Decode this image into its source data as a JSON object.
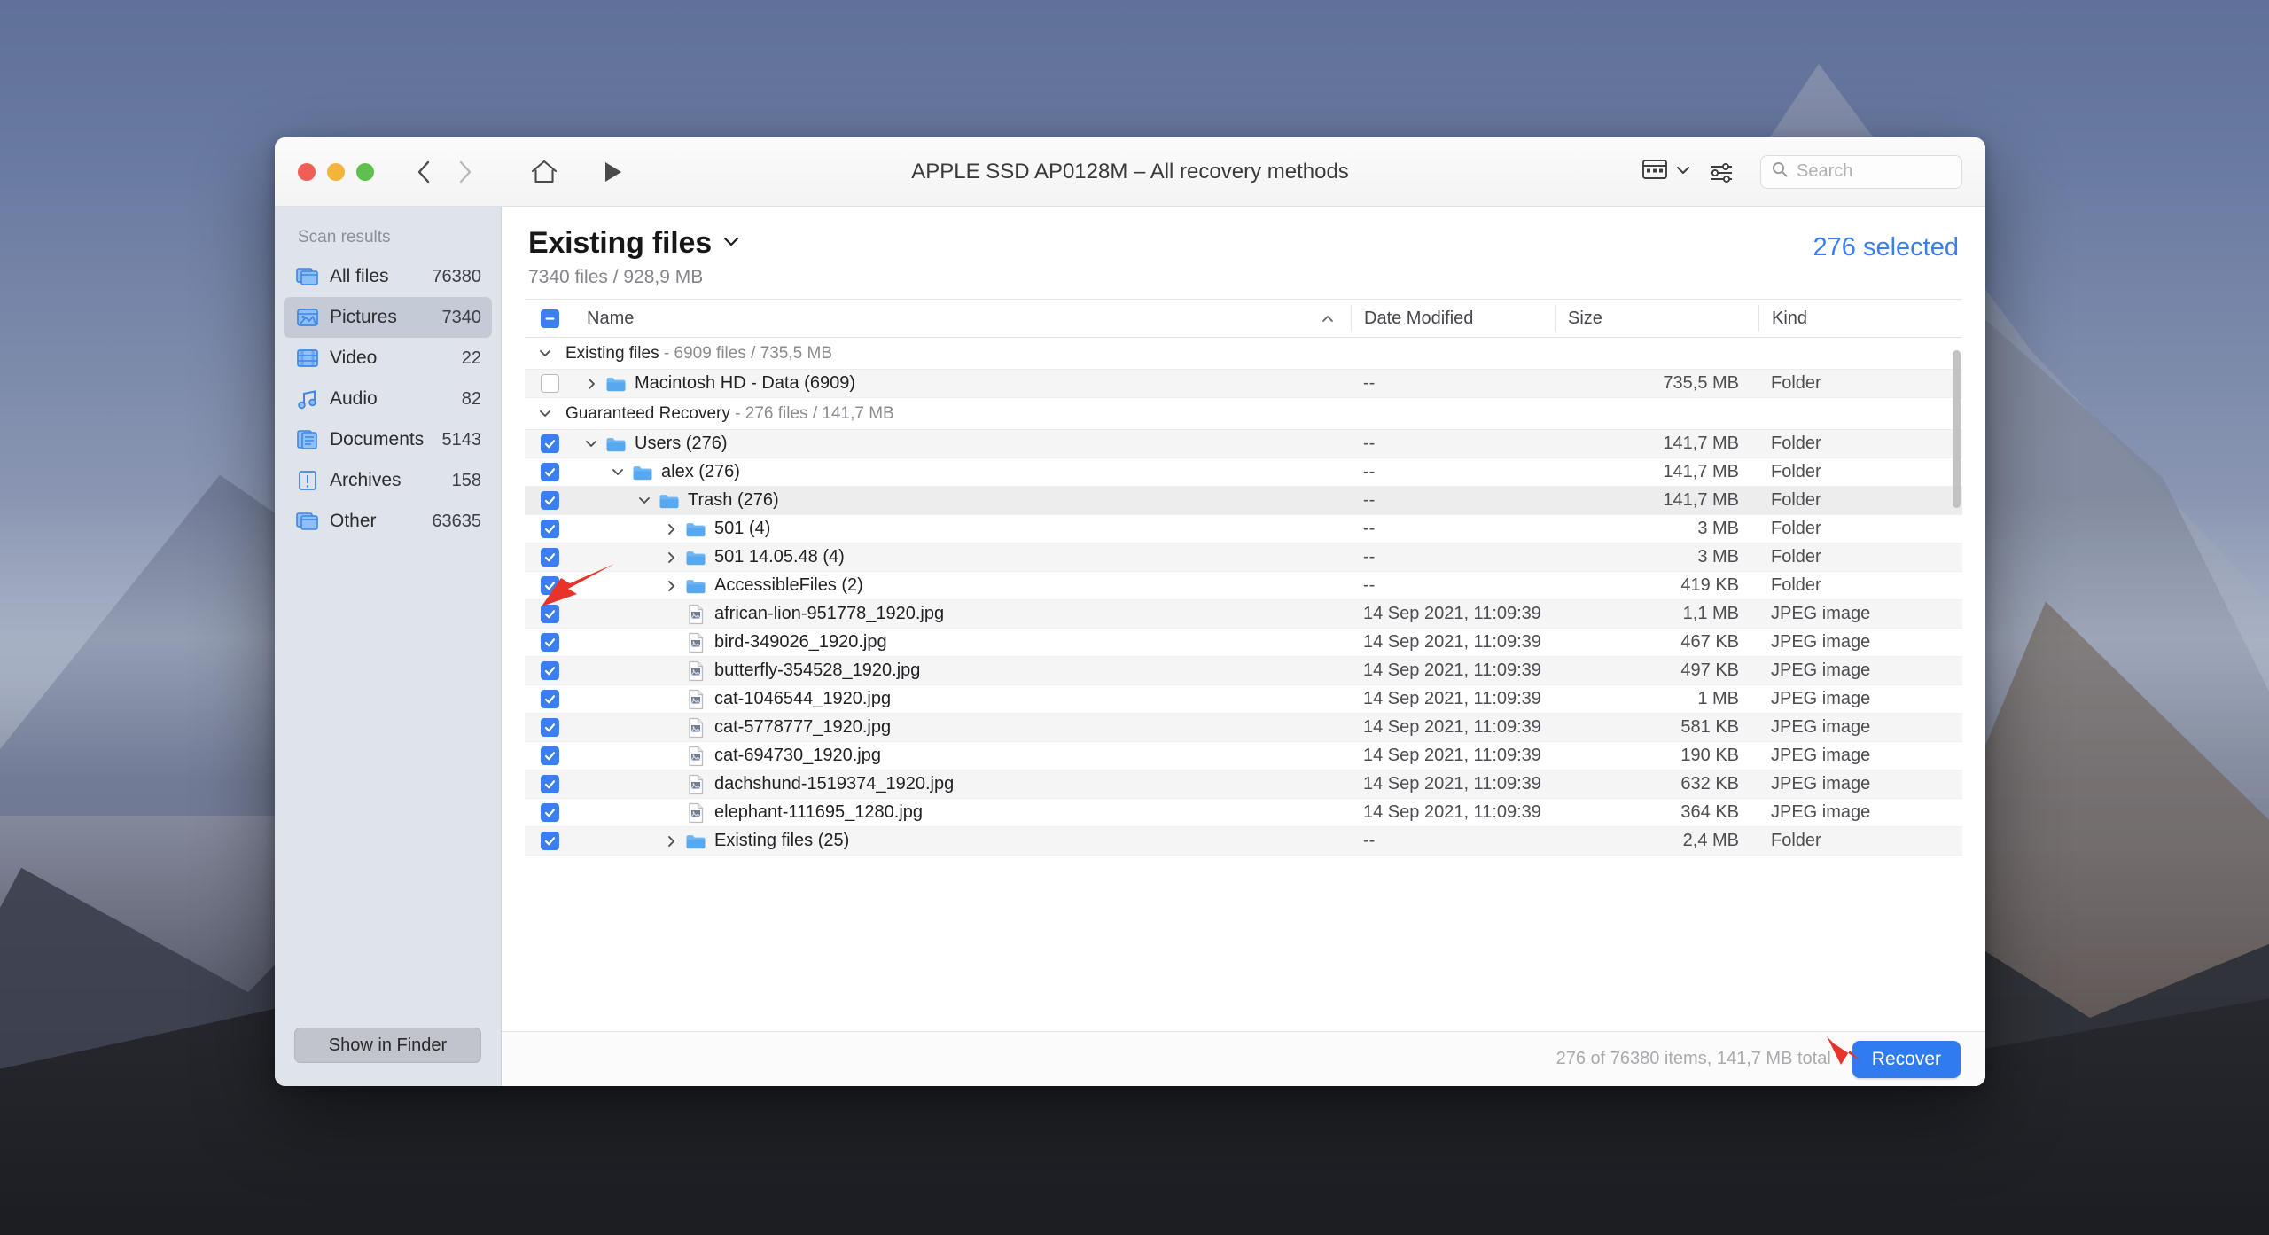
{
  "window": {
    "title": "APPLE SSD AP0128M – All recovery methods",
    "traffic_lights": [
      "close",
      "minimize",
      "zoom"
    ]
  },
  "toolbar": {
    "back_icon": "chevron-left-icon",
    "forward_icon": "chevron-right-icon",
    "home_icon": "home-icon",
    "play_icon": "play-icon",
    "view_icon": "view-grid-icon",
    "view_chevron_icon": "chevron-down-icon",
    "settings_icon": "sliders-icon",
    "search_icon": "search-icon",
    "search_placeholder": "Search",
    "search_value": ""
  },
  "sidebar": {
    "title": "Scan results",
    "items": [
      {
        "label": "All files",
        "count": "76380",
        "icon": "files-icon",
        "selected": false
      },
      {
        "label": "Pictures",
        "count": "7340",
        "icon": "picture-icon",
        "selected": true
      },
      {
        "label": "Video",
        "count": "22",
        "icon": "video-icon",
        "selected": false
      },
      {
        "label": "Audio",
        "count": "82",
        "icon": "audio-icon",
        "selected": false
      },
      {
        "label": "Documents",
        "count": "5143",
        "icon": "documents-icon",
        "selected": false
      },
      {
        "label": "Archives",
        "count": "158",
        "icon": "archive-icon",
        "selected": false
      },
      {
        "label": "Other",
        "count": "63635",
        "icon": "files-icon",
        "selected": false
      }
    ],
    "show_in_finder_label": "Show in Finder"
  },
  "main": {
    "page_title": "Existing files",
    "page_title_chevron": "chevron-down-icon",
    "page_subtitle": "7340 files / 928,9 MB",
    "selected_count_label": "276 selected"
  },
  "table": {
    "header_checkbox_state": "mixed",
    "columns": [
      {
        "key": "name",
        "label": "Name",
        "sort": "asc",
        "sort_icon": "caret-up-icon"
      },
      {
        "key": "date",
        "label": "Date Modified"
      },
      {
        "key": "size",
        "label": "Size"
      },
      {
        "key": "kind",
        "label": "Kind"
      }
    ],
    "rows": [
      {
        "type": "group",
        "twisty": "down",
        "title": "Existing files",
        "meta": "- 6909 files / 735,5 MB"
      },
      {
        "type": "item",
        "checked": false,
        "twisty": "right",
        "indent": 1,
        "icon": "folder-icon",
        "name": "Macintosh HD - Data (6909)",
        "date": "--",
        "size": "735,5 MB",
        "kind": "Folder",
        "zebra": true
      },
      {
        "type": "group",
        "twisty": "down",
        "title": "Guaranteed Recovery",
        "meta": "- 276 files / 141,7 MB"
      },
      {
        "type": "item",
        "checked": true,
        "twisty": "down",
        "indent": 1,
        "icon": "folder-icon",
        "name": "Users (276)",
        "date": "--",
        "size": "141,7 MB",
        "kind": "Folder",
        "zebra": true
      },
      {
        "type": "item",
        "checked": true,
        "twisty": "down",
        "indent": 2,
        "icon": "folder-icon",
        "name": "alex (276)",
        "date": "--",
        "size": "141,7 MB",
        "kind": "Folder",
        "zebra": false
      },
      {
        "type": "item",
        "checked": true,
        "twisty": "down",
        "indent": 3,
        "icon": "folder-icon",
        "name": "Trash (276)",
        "date": "--",
        "size": "141,7 MB",
        "kind": "Folder",
        "zebra": true,
        "highlight": true
      },
      {
        "type": "item",
        "checked": true,
        "twisty": "right",
        "indent": 4,
        "icon": "folder-icon",
        "name": "501 (4)",
        "date": "--",
        "size": "3 MB",
        "kind": "Folder",
        "zebra": false
      },
      {
        "type": "item",
        "checked": true,
        "twisty": "right",
        "indent": 4,
        "icon": "folder-icon",
        "name": "501 14.05.48 (4)",
        "date": "--",
        "size": "3 MB",
        "kind": "Folder",
        "zebra": true
      },
      {
        "type": "item",
        "checked": true,
        "twisty": "right",
        "indent": 4,
        "icon": "folder-icon",
        "name": "AccessibleFiles (2)",
        "date": "--",
        "size": "419 KB",
        "kind": "Folder",
        "zebra": false
      },
      {
        "type": "item",
        "checked": true,
        "twisty": "none",
        "indent": 4,
        "icon": "jpeg-file-icon",
        "name": "african-lion-951778_1920.jpg",
        "date": "14 Sep 2021, 11:09:39",
        "size": "1,1 MB",
        "kind": "JPEG image",
        "zebra": true
      },
      {
        "type": "item",
        "checked": true,
        "twisty": "none",
        "indent": 4,
        "icon": "jpeg-file-icon",
        "name": "bird-349026_1920.jpg",
        "date": "14 Sep 2021, 11:09:39",
        "size": "467 KB",
        "kind": "JPEG image",
        "zebra": false
      },
      {
        "type": "item",
        "checked": true,
        "twisty": "none",
        "indent": 4,
        "icon": "jpeg-file-icon",
        "name": "butterfly-354528_1920.jpg",
        "date": "14 Sep 2021, 11:09:39",
        "size": "497 KB",
        "kind": "JPEG image",
        "zebra": true
      },
      {
        "type": "item",
        "checked": true,
        "twisty": "none",
        "indent": 4,
        "icon": "jpeg-file-icon",
        "name": "cat-1046544_1920.jpg",
        "date": "14 Sep 2021, 11:09:39",
        "size": "1 MB",
        "kind": "JPEG image",
        "zebra": false
      },
      {
        "type": "item",
        "checked": true,
        "twisty": "none",
        "indent": 4,
        "icon": "jpeg-file-icon",
        "name": "cat-5778777_1920.jpg",
        "date": "14 Sep 2021, 11:09:39",
        "size": "581 KB",
        "kind": "JPEG image",
        "zebra": true
      },
      {
        "type": "item",
        "checked": true,
        "twisty": "none",
        "indent": 4,
        "icon": "jpeg-file-icon",
        "name": "cat-694730_1920.jpg",
        "date": "14 Sep 2021, 11:09:39",
        "size": "190 KB",
        "kind": "JPEG image",
        "zebra": false
      },
      {
        "type": "item",
        "checked": true,
        "twisty": "none",
        "indent": 4,
        "icon": "jpeg-file-icon",
        "name": "dachshund-1519374_1920.jpg",
        "date": "14 Sep 2021, 11:09:39",
        "size": "632 KB",
        "kind": "JPEG image",
        "zebra": true
      },
      {
        "type": "item",
        "checked": true,
        "twisty": "none",
        "indent": 4,
        "icon": "jpeg-file-icon",
        "name": "elephant-111695_1280.jpg",
        "date": "14 Sep 2021, 11:09:39",
        "size": "364 KB",
        "kind": "JPEG image",
        "zebra": false
      },
      {
        "type": "item",
        "checked": true,
        "twisty": "right",
        "indent": 4,
        "icon": "folder-icon",
        "name": "Existing files (25)",
        "date": "--",
        "size": "2,4 MB",
        "kind": "Folder",
        "zebra": true
      }
    ]
  },
  "footer": {
    "status": "276 of 76380 items, 141,7 MB total",
    "recover_label": "Recover"
  },
  "colors": {
    "accent_blue": "#3a7ef0",
    "recover_blue": "#2f7bef",
    "annotation_red": "#e8332a",
    "sidebar_bg": "#dfe3ea"
  }
}
